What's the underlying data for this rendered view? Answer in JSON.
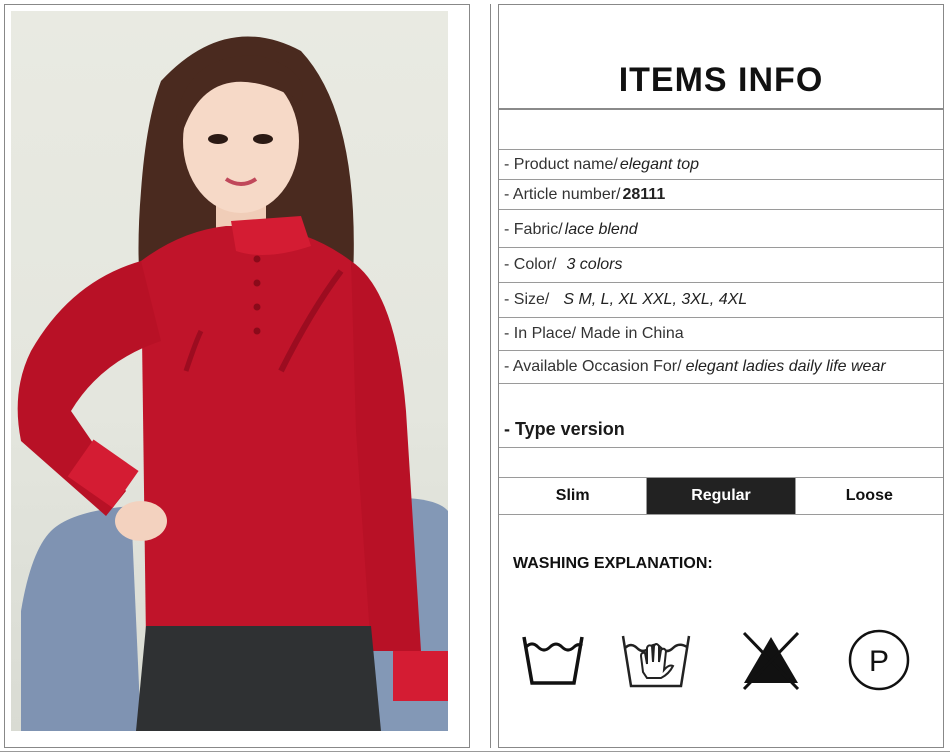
{
  "header": {
    "title": "ITEMS INFO"
  },
  "info": [
    {
      "label": "- Product name/",
      "value": "elegant top",
      "bold": false
    },
    {
      "label": "- Article number/",
      "value": "28111",
      "bold": true
    },
    {
      "label": "- Fabric/",
      "value": "lace blend",
      "bold": false
    },
    {
      "label": "- Color/",
      "value": "3 colors",
      "bold": false
    },
    {
      "label": "- Size/",
      "value": "S  M, L, XL XXL, 3XL, 4XL",
      "bold": false
    },
    {
      "label": "- In Place/ Made in China",
      "value": "",
      "bold": false
    },
    {
      "label": "- Available Occasion For/",
      "value": "elegant ladies daily life wear",
      "bold": false
    }
  ],
  "type_version": {
    "label": "- Type version"
  },
  "fit_tabs": [
    {
      "label": "Slim",
      "active": false
    },
    {
      "label": "Regular",
      "active": true
    },
    {
      "label": "Loose",
      "active": false
    }
  ],
  "washing": {
    "title": "WASHING EXPLANATION:",
    "icons": [
      "machine-wash-icon",
      "hand-wash-icon",
      "do-not-bleach-icon",
      "professional-dry-clean-icon"
    ],
    "icon_letter_p": "P"
  },
  "colors": {
    "active_tab": "#222222",
    "garment": "#c0142a"
  }
}
